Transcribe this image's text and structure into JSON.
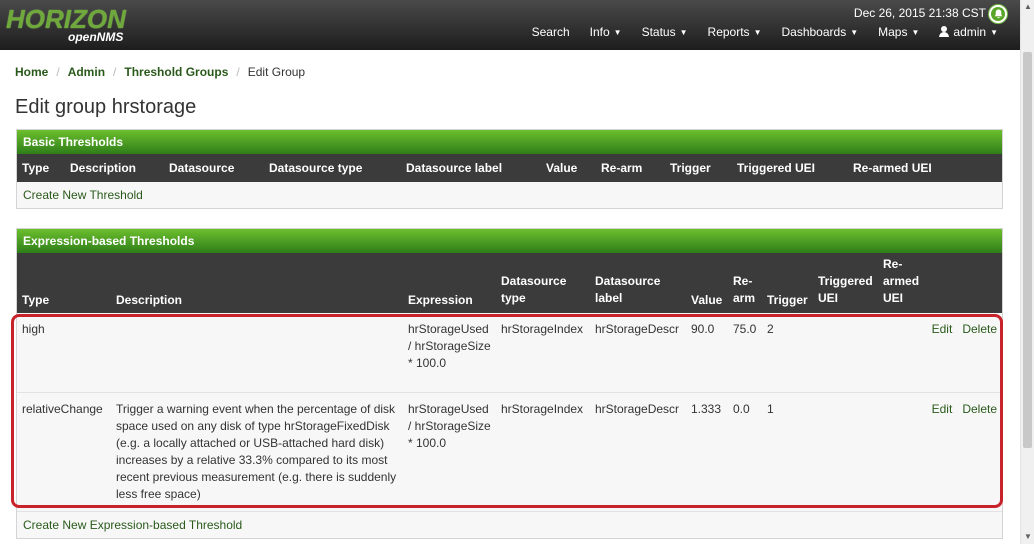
{
  "header": {
    "logo_main": "HORIZON",
    "logo_sub": "openNMS",
    "datetime": "Dec 26, 2015 21:38 CST",
    "nav": [
      {
        "label": "Search",
        "caret": false
      },
      {
        "label": "Info",
        "caret": true
      },
      {
        "label": "Status",
        "caret": true
      },
      {
        "label": "Reports",
        "caret": true
      },
      {
        "label": "Dashboards",
        "caret": true
      },
      {
        "label": "Maps",
        "caret": true
      },
      {
        "label": "admin",
        "caret": true
      }
    ]
  },
  "breadcrumb": {
    "home": "Home",
    "admin": "Admin",
    "threshold_groups": "Threshold Groups",
    "current": "Edit Group",
    "sep": "/"
  },
  "page_title": "Edit group hrstorage",
  "basic": {
    "title": "Basic Thresholds",
    "columns": [
      "Type",
      "Description",
      "Datasource",
      "Datasource type",
      "Datasource label",
      "Value",
      "Re-arm",
      "Trigger",
      "Triggered UEI",
      "Re-armed UEI"
    ],
    "create_link": "Create New Threshold"
  },
  "expression": {
    "title": "Expression-based Thresholds",
    "columns": [
      "Type",
      "Description",
      "Expression",
      "Datasource type",
      "Datasource label",
      "Value",
      "Re-arm",
      "Trigger",
      "Triggered UEI",
      "Re-armed UEI"
    ],
    "rows": [
      {
        "type": "high",
        "description": "",
        "expression": "hrStorageUsed / hrStorageSize * 100.0",
        "ds_type": "hrStorageIndex",
        "ds_label": "hrStorageDescr",
        "value": "90.0",
        "rearm": "75.0",
        "trigger": "2",
        "triggered_uei": "",
        "rearmed_uei": "",
        "edit": "Edit",
        "delete": "Delete"
      },
      {
        "type": "relativeChange",
        "description": "Trigger a warning event when the percentage of disk space used on any disk of type hrStorageFixedDisk (e.g. a locally attached or USB-attached hard disk) increases by a relative 33.3% compared to its most recent previous measurement (e.g. there is suddenly less free space)",
        "expression": "hrStorageUsed / hrStorageSize * 100.0",
        "ds_type": "hrStorageIndex",
        "ds_label": "hrStorageDescr",
        "value": "1.333",
        "rearm": "0.0",
        "trigger": "1",
        "triggered_uei": "",
        "rearmed_uei": "",
        "edit": "Edit",
        "delete": "Delete"
      }
    ],
    "create_link": "Create New Expression-based Threshold"
  },
  "colors": {
    "brand_green": "#6fa83b",
    "panel_header_top": "#6cbf2d",
    "panel_header_bottom": "#2e7d1a",
    "link": "#2a5a1b",
    "highlight": "#c8232b"
  }
}
